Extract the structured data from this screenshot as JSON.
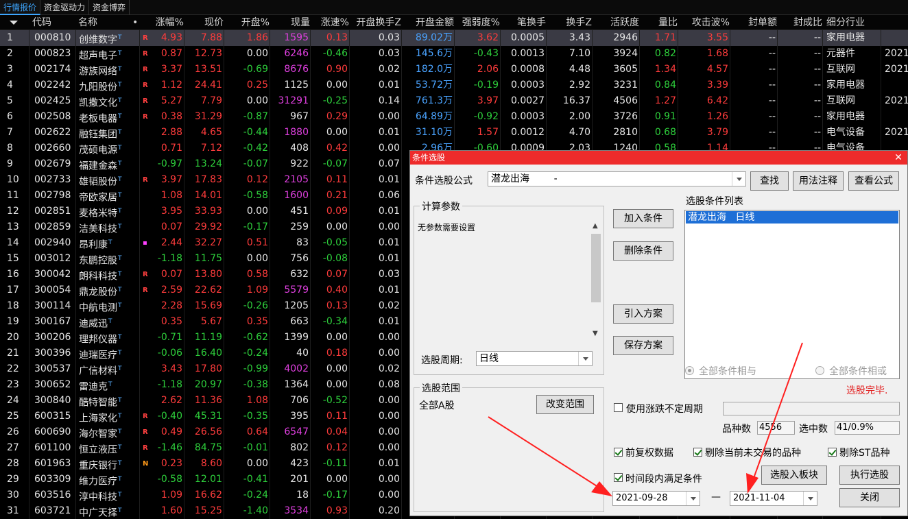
{
  "tabs": [
    "行情报价",
    "资金驱动力",
    "资金博弈"
  ],
  "headers": [
    "代码",
    "名称",
    "•",
    "涨幅%",
    "现价",
    "开盘%",
    "现量",
    "涨速%",
    "开盘换手Z",
    "开盘金额",
    "强弱度%",
    "笔换手",
    "换手Z",
    "活跃度",
    "量比",
    "攻击波%",
    "封单额",
    "封成比",
    "细分行业"
  ],
  "rows": [
    {
      "idx": "1",
      "code": "000810",
      "name": "创维数字",
      "flag": "R",
      "chg": "4.93",
      "price": "7.88",
      "open": "1.86",
      "vol": "1595",
      "speed": "0.13",
      "oturn": "0.03",
      "oamt": "89.02万",
      "str": "3.62",
      "bturn": "0.0005",
      "turn": "3.43",
      "act": "2946",
      "vr": "1.71",
      "atk": "3.55",
      "fd": "--",
      "fc": "--",
      "ind": "家用电器",
      "ext": ""
    },
    {
      "idx": "2",
      "code": "000823",
      "name": "超声电子",
      "flag": "R",
      "chg": "0.87",
      "price": "12.73",
      "open": "0.00",
      "vol": "6246",
      "speed": "-0.46",
      "oturn": "0.03",
      "oamt": "145.6万",
      "str": "-0.43",
      "bturn": "0.0013",
      "turn": "7.10",
      "act": "3924",
      "vr": "0.82",
      "atk": "1.68",
      "fd": "--",
      "fc": "--",
      "ind": "元器件",
      "ext": "2021"
    },
    {
      "idx": "3",
      "code": "002174",
      "name": "游族网络",
      "flag": "R",
      "chg": "3.37",
      "price": "13.51",
      "open": "-0.69",
      "vol": "8676",
      "speed": "0.90",
      "oturn": "0.02",
      "oamt": "182.0万",
      "str": "2.06",
      "bturn": "0.0008",
      "turn": "4.48",
      "act": "3605",
      "vr": "1.34",
      "atk": "4.57",
      "fd": "--",
      "fc": "--",
      "ind": "互联网",
      "ext": "2021"
    },
    {
      "idx": "4",
      "code": "002242",
      "name": "九阳股份",
      "flag": "R",
      "chg": "1.12",
      "price": "24.41",
      "open": "0.25",
      "vol": "1125",
      "speed": "0.00",
      "oturn": "0.01",
      "oamt": "53.72万",
      "str": "-0.19",
      "bturn": "0.0003",
      "turn": "2.92",
      "act": "3231",
      "vr": "0.84",
      "atk": "3.39",
      "fd": "--",
      "fc": "--",
      "ind": "家用电器",
      "ext": ""
    },
    {
      "idx": "5",
      "code": "002425",
      "name": "凯撒文化",
      "flag": "R",
      "chg": "5.27",
      "price": "7.79",
      "open": "0.00",
      "vol": "31291",
      "speed": "-0.25",
      "oturn": "0.14",
      "oamt": "761.3万",
      "str": "3.97",
      "bturn": "0.0027",
      "turn": "16.37",
      "act": "4506",
      "vr": "1.27",
      "atk": "6.42",
      "fd": "--",
      "fc": "--",
      "ind": "互联网",
      "ext": "2021"
    },
    {
      "idx": "6",
      "code": "002508",
      "name": "老板电器",
      "flag": "R",
      "chg": "0.38",
      "price": "31.29",
      "open": "-0.87",
      "vol": "967",
      "speed": "0.29",
      "oturn": "0.00",
      "oamt": "64.89万",
      "str": "-0.92",
      "bturn": "0.0003",
      "turn": "2.00",
      "act": "3726",
      "vr": "0.91",
      "atk": "1.26",
      "fd": "--",
      "fc": "--",
      "ind": "家用电器",
      "ext": ""
    },
    {
      "idx": "7",
      "code": "002622",
      "name": "融钰集团",
      "flag": "",
      "chg": "2.88",
      "price": "4.65",
      "open": "-0.44",
      "vol": "1880",
      "speed": "0.00",
      "oturn": "0.01",
      "oamt": "31.10万",
      "str": "1.57",
      "bturn": "0.0012",
      "turn": "4.70",
      "act": "2810",
      "vr": "0.68",
      "atk": "3.79",
      "fd": "--",
      "fc": "--",
      "ind": "电气设备",
      "ext": "2021"
    },
    {
      "idx": "8",
      "code": "002660",
      "name": "茂硕电源",
      "flag": "",
      "chg": "0.71",
      "price": "7.12",
      "open": "-0.42",
      "vol": "408",
      "speed": "0.42",
      "oturn": "0.00",
      "oamt": "2.96万",
      "str": "-0.60",
      "bturn": "0.0009",
      "turn": "2.03",
      "act": "1240",
      "vr": "0.58",
      "atk": "1.14",
      "fd": "--",
      "fc": "--",
      "ind": "电气设备",
      "ext": ""
    },
    {
      "idx": "9",
      "code": "002679",
      "name": "福建金森",
      "flag": "",
      "chg": "-0.97",
      "price": "13.24",
      "open": "-0.07",
      "vol": "922",
      "speed": "-0.07",
      "oturn": "0.07"
    },
    {
      "idx": "10",
      "code": "002733",
      "name": "雄韬股份",
      "flag": "R",
      "chg": "3.97",
      "price": "17.83",
      "open": "0.12",
      "vol": "2105",
      "speed": "0.11",
      "oturn": "0.01"
    },
    {
      "idx": "11",
      "code": "002798",
      "name": "帝欧家居",
      "flag": "",
      "chg": "1.08",
      "price": "14.01",
      "open": "-0.58",
      "vol": "1600",
      "speed": "0.21",
      "oturn": "0.06"
    },
    {
      "idx": "12",
      "code": "002851",
      "name": "麦格米特",
      "flag": "",
      "chg": "3.95",
      "price": "33.93",
      "open": "0.00",
      "vol": "451",
      "speed": "0.09",
      "oturn": "0.01"
    },
    {
      "idx": "13",
      "code": "002859",
      "name": "洁美科技",
      "flag": "",
      "chg": "0.07",
      "price": "29.92",
      "open": "-0.17",
      "vol": "259",
      "speed": "0.00",
      "oturn": "0.00"
    },
    {
      "idx": "14",
      "code": "002940",
      "name": "昂利康",
      "flag": "dot",
      "chg": "2.44",
      "price": "32.27",
      "open": "0.51",
      "vol": "83",
      "speed": "-0.05",
      "oturn": "0.01"
    },
    {
      "idx": "15",
      "code": "003012",
      "name": "东鹏控股",
      "flag": "",
      "chg": "-1.18",
      "price": "11.75",
      "open": "0.00",
      "vol": "756",
      "speed": "-0.08",
      "oturn": "0.01"
    },
    {
      "idx": "16",
      "code": "300042",
      "name": "朗科科技",
      "flag": "R",
      "chg": "0.07",
      "price": "13.80",
      "open": "0.58",
      "vol": "632",
      "speed": "0.07",
      "oturn": "0.03"
    },
    {
      "idx": "17",
      "code": "300054",
      "name": "鼎龙股份",
      "flag": "R",
      "chg": "2.59",
      "price": "22.62",
      "open": "1.09",
      "vol": "5579",
      "speed": "0.40",
      "oturn": "0.01"
    },
    {
      "idx": "18",
      "code": "300114",
      "name": "中航电测",
      "flag": "",
      "chg": "2.28",
      "price": "15.69",
      "open": "-0.26",
      "vol": "1205",
      "speed": "0.13",
      "oturn": "0.02"
    },
    {
      "idx": "19",
      "code": "300167",
      "name": "迪威迅",
      "flag": "",
      "chg": "0.35",
      "price": "5.67",
      "open": "0.35",
      "vol": "663",
      "speed": "-0.34",
      "oturn": "0.01"
    },
    {
      "idx": "20",
      "code": "300206",
      "name": "理邦仪器",
      "flag": "",
      "chg": "-0.71",
      "price": "11.19",
      "open": "-0.62",
      "vol": "1399",
      "speed": "0.00",
      "oturn": "0.00"
    },
    {
      "idx": "21",
      "code": "300396",
      "name": "迪瑞医疗",
      "flag": "",
      "chg": "-0.06",
      "price": "16.40",
      "open": "-0.24",
      "vol": "40",
      "speed": "0.18",
      "oturn": "0.00"
    },
    {
      "idx": "22",
      "code": "300537",
      "name": "广信材料",
      "flag": "",
      "chg": "3.43",
      "price": "17.80",
      "open": "-0.99",
      "vol": "4002",
      "speed": "0.00",
      "oturn": "0.02"
    },
    {
      "idx": "23",
      "code": "300652",
      "name": "雷迪克",
      "flag": "",
      "chg": "-1.18",
      "price": "20.97",
      "open": "-0.38",
      "vol": "1364",
      "speed": "0.00",
      "oturn": "0.08"
    },
    {
      "idx": "24",
      "code": "300840",
      "name": "酷特智能",
      "flag": "",
      "chg": "2.62",
      "price": "11.36",
      "open": "1.08",
      "vol": "706",
      "speed": "-0.52",
      "oturn": "0.00"
    },
    {
      "idx": "25",
      "code": "600315",
      "name": "上海家化",
      "flag": "R",
      "chg": "-0.40",
      "price": "45.31",
      "open": "-0.35",
      "vol": "395",
      "speed": "0.11",
      "oturn": "0.00"
    },
    {
      "idx": "26",
      "code": "600690",
      "name": "海尔智家",
      "flag": "R",
      "chg": "0.49",
      "price": "26.56",
      "open": "0.64",
      "vol": "6547",
      "speed": "0.04",
      "oturn": "0.00"
    },
    {
      "idx": "27",
      "code": "601100",
      "name": "恒立液压",
      "flag": "R",
      "chg": "-1.46",
      "price": "84.75",
      "open": "-0.01",
      "vol": "802",
      "speed": "0.12",
      "oturn": "0.00"
    },
    {
      "idx": "28",
      "code": "601963",
      "name": "重庆银行",
      "flag": "N",
      "chg": "0.23",
      "price": "8.60",
      "open": "0.00",
      "vol": "423",
      "speed": "-0.11",
      "oturn": "0.01"
    },
    {
      "idx": "29",
      "code": "603309",
      "name": "维力医疗",
      "flag": "",
      "chg": "-0.58",
      "price": "12.01",
      "open": "-0.41",
      "vol": "201",
      "speed": "0.00",
      "oturn": "0.00"
    },
    {
      "idx": "30",
      "code": "603516",
      "name": "淳中科技",
      "flag": "",
      "chg": "1.09",
      "price": "16.62",
      "open": "-0.24",
      "vol": "18",
      "speed": "-0.17",
      "oturn": "0.00"
    },
    {
      "idx": "31",
      "code": "603721",
      "name": "中广天择",
      "flag": "",
      "chg": "1.60",
      "price": "15.25",
      "open": "-1.40",
      "vol": "3534",
      "speed": "0.93",
      "oturn": "0.20"
    }
  ],
  "dialog": {
    "title": "条件选股",
    "close": "✕",
    "formula_label": "条件选股公式",
    "formula_value": "潜龙出海        -",
    "find": "查找",
    "usage": "用法注释",
    "view_formula": "查看公式",
    "params_group": "计算参数",
    "params_text": "无参数需要设置",
    "period_label": "选股周期:",
    "period_value": "日线",
    "scope_group": "选股范围",
    "scope_value": "全部A股",
    "change_scope": "改变范围",
    "add_cond": "加入条件",
    "del_cond": "删除条件",
    "import_plan": "引入方案",
    "save_plan": "保存方案",
    "cond_list_label": "选股条件列表",
    "cond_item": "潜龙出海   日线",
    "radio_and": "全部条件相与",
    "radio_or": "全部条件相或",
    "status": "选股完毕.",
    "use_indef": "使用涨跌不定周期",
    "count_label": "品种数",
    "count_value": "4556",
    "selected_label": "选中数",
    "selected_value": "41/0.9%",
    "adj_data": "前复权数据",
    "excl_untraded": "剔除当前未交易的品种",
    "excl_st": "剔除ST品种",
    "time_range": "时间段内满足条件",
    "to_block": "选股入板块",
    "execute": "执行选股",
    "date_from": "2021-09-28",
    "date_sep": "—",
    "date_to": "2021-11-04",
    "close_btn": "关闭"
  },
  "colors": {
    "up": "#ff3c3c",
    "down": "#2ed03c",
    "blue": "#4aa3ff",
    "magenta": "#e040e0",
    "dialog_title": "#ee2b2b",
    "selection": "#1e6fd6"
  }
}
